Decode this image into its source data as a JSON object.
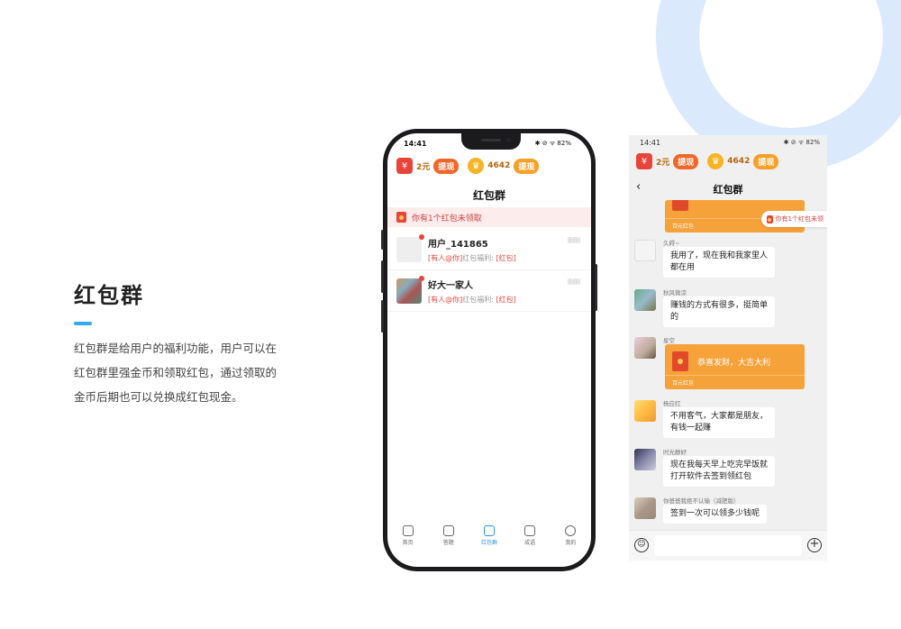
{
  "intro": {
    "title": "红包群",
    "description": "红包群是给用户的福利功能，用户可以在红包群里强金币和领取红包，通过领取的金币后期也可以兑换成红包现金。"
  },
  "phone": {
    "status": {
      "time": "14:41",
      "icons": "✱ ⊘ ᯤ 82%"
    },
    "wallet": {
      "cash": "2元",
      "cash_action": "提现",
      "coins": "4642",
      "coins_action": "提现"
    },
    "title": "红包群",
    "notice": "你有1个红包未领取",
    "chats": [
      {
        "name": "用户_141865",
        "tag": "[有人@你]",
        "preview": "红包福利:",
        "badge": "[红包]",
        "time": "刚刚"
      },
      {
        "name": "好大一家人",
        "tag": "[有人@你]",
        "preview": "红包福利:",
        "badge": "[红包]",
        "time": "刚刚"
      }
    ],
    "tabs": [
      {
        "label": "首页",
        "icon": "home-icon"
      },
      {
        "label": "答题",
        "icon": "quiz-icon"
      },
      {
        "label": "红包群",
        "icon": "redpacket-group-icon",
        "active": true
      },
      {
        "label": "成语",
        "icon": "idiom-icon"
      },
      {
        "label": "我的",
        "icon": "profile-icon"
      }
    ]
  },
  "chat": {
    "status": {
      "time": "14:41",
      "icons": "✱ ⊘ ᯤ 82%"
    },
    "wallet": {
      "cash": "2元",
      "cash_action": "提现",
      "coins": "4642",
      "coins_action": "提现"
    },
    "title": "红包群",
    "back_icon": "back-arrow-icon",
    "float_notice": "你有1个红包未领",
    "top_packet": {
      "footer": "百元红包"
    },
    "messages": [
      {
        "name": "久碍~",
        "text_lines": [
          "我用了，现在我和我家里人",
          "都在用"
        ]
      },
      {
        "name": "秋风微凉",
        "text_lines": [
          "赚钱的方式有很多，挺简单",
          "的"
        ]
      },
      {
        "name": "星空",
        "packet_text": "恭喜发财，大吉大利",
        "packet_footer": "百元红包"
      },
      {
        "name": "杨应红",
        "text_lines": [
          "不用客气，大家都是朋友，",
          "有钱一起赚"
        ]
      },
      {
        "name": "时光静好",
        "text_lines": [
          "现在我每天早上吃完早饭就",
          "打开软件去签到领红包"
        ]
      },
      {
        "name": "你爸爸我绝不认输（减肥版）",
        "text_lines": [
          "签到一次可以领多少钱呢"
        ]
      }
    ],
    "input": {
      "placeholder": ""
    }
  }
}
